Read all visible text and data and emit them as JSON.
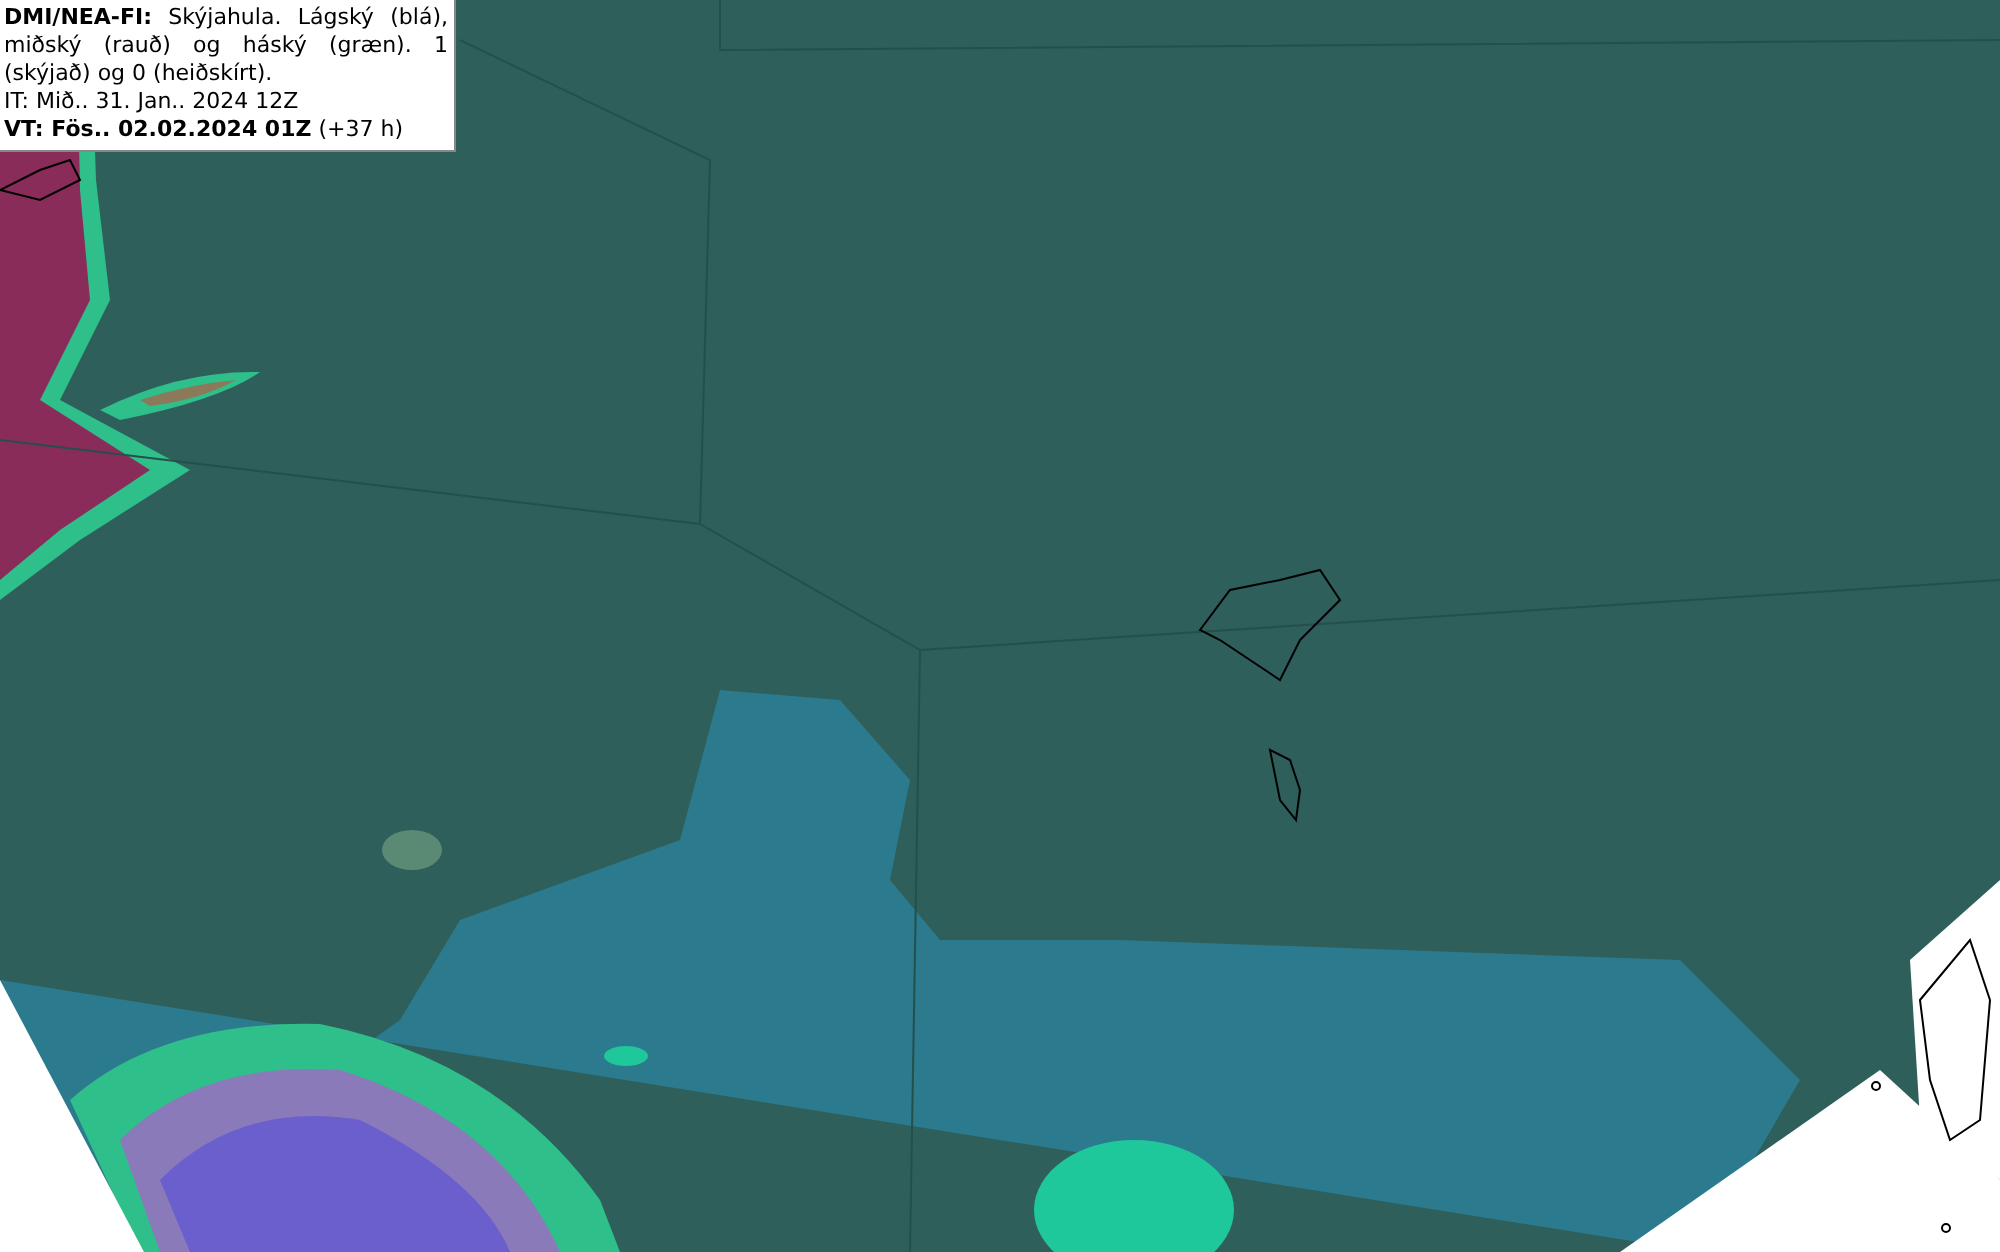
{
  "legend": {
    "description": "**DMI/NEA-FI:** Skýjahula. Lágský (blá), miðský (rauð) og háský (græn). 1 (skýjað) og 0 (heiðskírt).",
    "initial_time": "IT: Mið.. 31. Jan.. 2024 12Z",
    "valid_time": "**VT: Fös.. 02.02.2024 01Z** (+37 h)"
  }
}
